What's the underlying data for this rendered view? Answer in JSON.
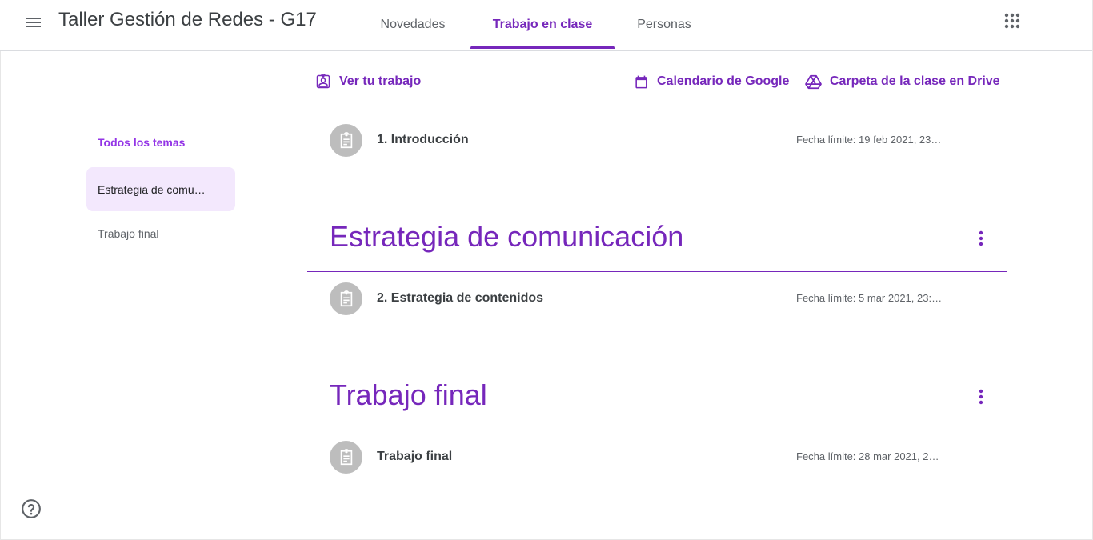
{
  "header": {
    "class_title": "Taller Gestión de Redes - G17",
    "tabs": [
      {
        "label": "Novedades"
      },
      {
        "label": "Trabajo en clase"
      },
      {
        "label": "Personas"
      }
    ]
  },
  "toolbar": {
    "view_work": "Ver tu trabajo",
    "calendar": "Calendario de Google",
    "drive": "Carpeta de la clase en Drive"
  },
  "sidebar": {
    "all_topics": "Todos los temas",
    "topics": [
      {
        "label": "Estrategia de comu…"
      },
      {
        "label": "Trabajo final"
      }
    ]
  },
  "assignments": [
    {
      "title": "1. Introducción",
      "due": "Fecha límite: 19 feb 2021, 23…"
    },
    {
      "title": "2. Estrategia de contenidos",
      "due": "Fecha límite: 5 mar 2021, 23:…"
    },
    {
      "title": "Trabajo final",
      "due": "Fecha límite: 28 mar 2021, 2…"
    }
  ],
  "sections": [
    {
      "title": "Estrategia de comunicación"
    },
    {
      "title": "Trabajo final"
    }
  ],
  "colors": {
    "accent": "#7627bb",
    "accent_light": "#9334e6",
    "selected_bg": "#f3e8fd",
    "icon_gray": "#bdbdbd"
  },
  "icons": [
    "menu-icon",
    "apps-grid-icon",
    "assignment-icon",
    "calendar-icon",
    "drive-icon",
    "more-vert-icon",
    "help-icon"
  ]
}
